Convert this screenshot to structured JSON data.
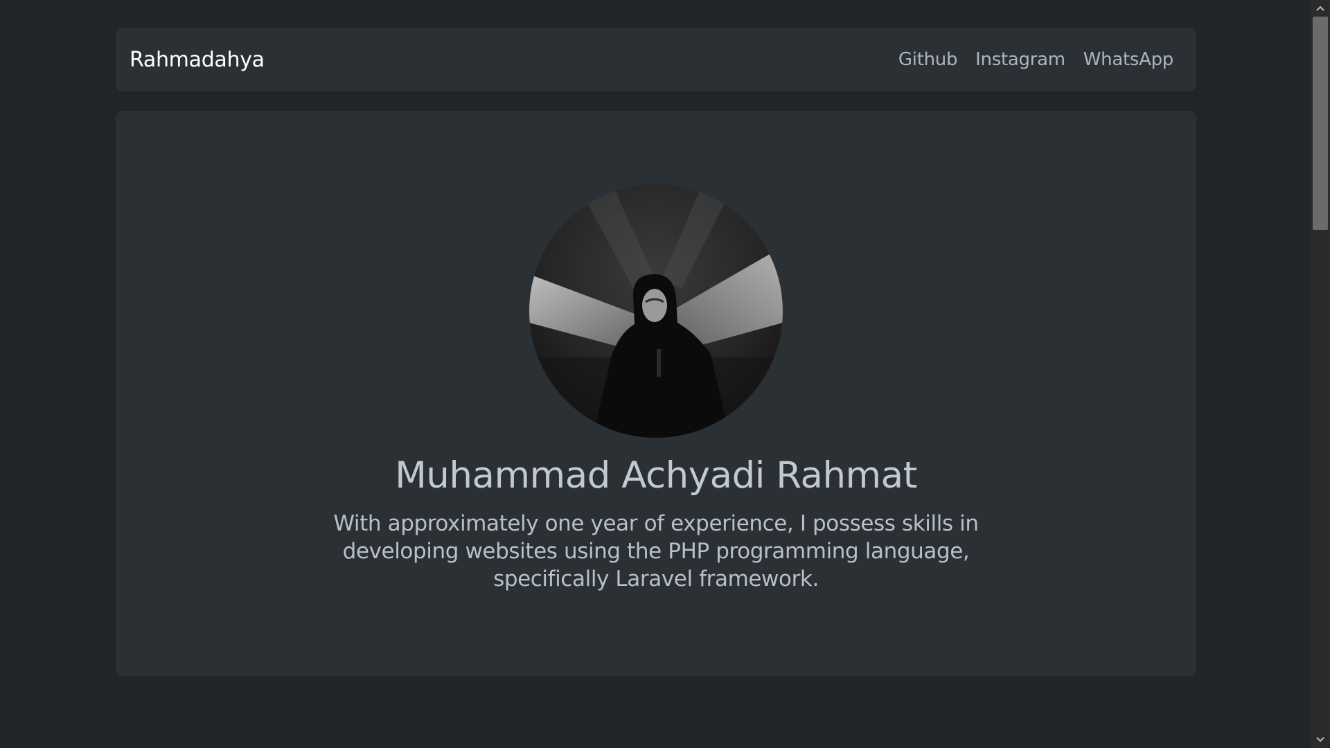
{
  "navbar": {
    "brand": "Rahmadahya",
    "links": [
      {
        "label": "Github"
      },
      {
        "label": "Instagram"
      },
      {
        "label": "WhatsApp"
      }
    ]
  },
  "hero": {
    "avatar_icon": "profile-photo",
    "name": "Muhammad Achyadi Rahmat",
    "bio": "With approximately one year of experience, I possess skills in developing websites using the PHP programming language, specifically Laravel framework."
  },
  "colors": {
    "page_background": "#212529",
    "card_background": "#2b3035",
    "brand_text": "#ffffff",
    "nav_link_text": "#adb5bd",
    "heading_text": "#c3c9d0"
  }
}
